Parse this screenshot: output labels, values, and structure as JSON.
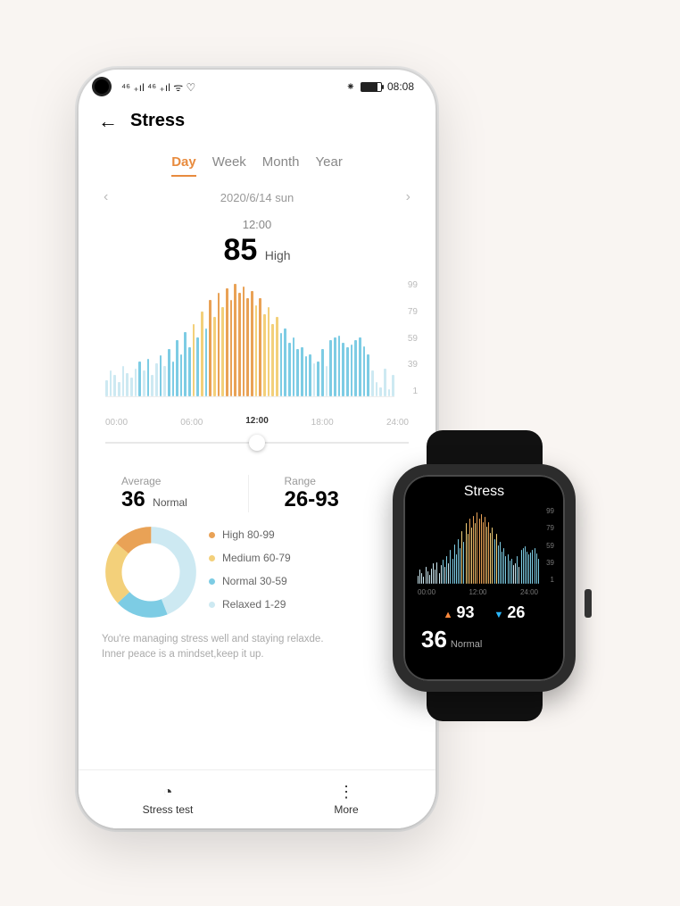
{
  "statusbar": {
    "signal_icons": "⁴⁶ ₊ıl ⁴⁶ ₊ıl  ᯤ  ♡",
    "bt_icon": "⁕",
    "time": "08:08"
  },
  "header": {
    "title": "Stress"
  },
  "tabs": [
    "Day",
    "Week",
    "Month",
    "Year"
  ],
  "active_tab": 0,
  "date_nav": {
    "date": "2020/6/14 sun"
  },
  "reading": {
    "time": "12:00",
    "value": "85",
    "level": "High"
  },
  "chart_data": {
    "type": "bar",
    "ylim": [
      0,
      99
    ],
    "y_ticks": [
      99,
      79,
      59,
      39,
      1
    ],
    "x_ticks": [
      "00:00",
      "06:00",
      "12:00",
      "18:00",
      "24:00"
    ],
    "current_x": "12:00",
    "current_x_pct": 50,
    "values": [
      14,
      22,
      18,
      12,
      26,
      20,
      16,
      24,
      30,
      22,
      32,
      18,
      28,
      35,
      26,
      40,
      30,
      48,
      36,
      55,
      42,
      62,
      50,
      72,
      58,
      82,
      68,
      88,
      76,
      92,
      82,
      96,
      88,
      94,
      84,
      90,
      78,
      84,
      70,
      76,
      62,
      68,
      54,
      58,
      46,
      50,
      40,
      42,
      34,
      36,
      28,
      30,
      40,
      26,
      48,
      50,
      52,
      46,
      42,
      44,
      48,
      50,
      43,
      36,
      22,
      12,
      8,
      24,
      6,
      18
    ]
  },
  "stats": {
    "average": {
      "label": "Average",
      "value": "36",
      "suffix": "Normal"
    },
    "range": {
      "label": "Range",
      "value": "26-93",
      "suffix": ""
    }
  },
  "breakdown": {
    "colors": {
      "high": "#e9a256",
      "medium": "#f3d07a",
      "normal": "#7dcce4",
      "relaxed": "#cde9f2"
    },
    "items": [
      {
        "key": "high",
        "label": "High 80-99",
        "pct": "14%"
      },
      {
        "key": "medium",
        "label": "Medium 60-79",
        "pct": "23%"
      },
      {
        "key": "normal",
        "label": "Normal 30-59",
        "pct": "19%"
      },
      {
        "key": "relaxed",
        "label": "Relaxed 1-29",
        "pct": "44%"
      }
    ]
  },
  "message": {
    "line1": "You're managing stress well and staying relaxde.",
    "line2": "Inner peace is a mindset,keep it up."
  },
  "bottombar": {
    "stress_test": "Stress test",
    "more": "More"
  },
  "watch": {
    "title": "Stress",
    "y_ticks": [
      99,
      79,
      59,
      39,
      1
    ],
    "x_ticks": [
      "00:00",
      "12:00",
      "24:00"
    ],
    "values": [
      10,
      18,
      14,
      9,
      22,
      16,
      12,
      20,
      26,
      18,
      28,
      14,
      24,
      31,
      22,
      36,
      26,
      44,
      32,
      51,
      38,
      58,
      46,
      68,
      54,
      78,
      64,
      84,
      72,
      88,
      78,
      92,
      84,
      90,
      80,
      86,
      74,
      80,
      66,
      72,
      58,
      64,
      50,
      54,
      42,
      46,
      36,
      38,
      30,
      32,
      24,
      26,
      36,
      22,
      44,
      46,
      48,
      42,
      38,
      40,
      44,
      46,
      39,
      32
    ],
    "high": "93",
    "low": "26",
    "current": {
      "value": "36",
      "label": "Normal"
    }
  }
}
